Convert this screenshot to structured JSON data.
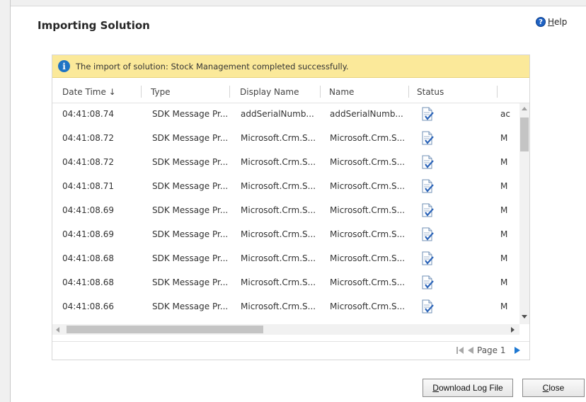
{
  "dialog": {
    "title": "Importing Solution",
    "help_label_first": "H",
    "help_label_rest": "elp"
  },
  "notice": {
    "icon": "info-icon",
    "message": "The import of solution: Stock Management completed successfully."
  },
  "grid": {
    "columns": [
      "Date Time ↓",
      "Type",
      "Display Name",
      "Name",
      "Status"
    ],
    "rows": [
      {
        "datetime": "04:41:08.74",
        "type": "SDK Message Pr...",
        "display_name": "addSerialNumb...",
        "name": "addSerialNumb...",
        "status_icon": "status-complete-icon",
        "extra": "ac"
      },
      {
        "datetime": "04:41:08.72",
        "type": "SDK Message Pr...",
        "display_name": "Microsoft.Crm.S...",
        "name": "Microsoft.Crm.S...",
        "status_icon": "status-complete-icon",
        "extra": "M"
      },
      {
        "datetime": "04:41:08.72",
        "type": "SDK Message Pr...",
        "display_name": "Microsoft.Crm.S...",
        "name": "Microsoft.Crm.S...",
        "status_icon": "status-complete-icon",
        "extra": "M"
      },
      {
        "datetime": "04:41:08.71",
        "type": "SDK Message Pr...",
        "display_name": "Microsoft.Crm.S...",
        "name": "Microsoft.Crm.S...",
        "status_icon": "status-complete-icon",
        "extra": "M"
      },
      {
        "datetime": "04:41:08.69",
        "type": "SDK Message Pr...",
        "display_name": "Microsoft.Crm.S...",
        "name": "Microsoft.Crm.S...",
        "status_icon": "status-complete-icon",
        "extra": "M"
      },
      {
        "datetime": "04:41:08.69",
        "type": "SDK Message Pr...",
        "display_name": "Microsoft.Crm.S...",
        "name": "Microsoft.Crm.S...",
        "status_icon": "status-complete-icon",
        "extra": "M"
      },
      {
        "datetime": "04:41:08.68",
        "type": "SDK Message Pr...",
        "display_name": "Microsoft.Crm.S...",
        "name": "Microsoft.Crm.S...",
        "status_icon": "status-complete-icon",
        "extra": "M"
      },
      {
        "datetime": "04:41:08.68",
        "type": "SDK Message Pr...",
        "display_name": "Microsoft.Crm.S...",
        "name": "Microsoft.Crm.S...",
        "status_icon": "status-complete-icon",
        "extra": "M"
      },
      {
        "datetime": "04:41:08.66",
        "type": "SDK Message Pr...",
        "display_name": "Microsoft.Crm.S...",
        "name": "Microsoft.Crm.S...",
        "status_icon": "status-complete-icon",
        "extra": "M"
      }
    ]
  },
  "pager": {
    "page_label": "Page 1"
  },
  "buttons": {
    "download_first": "D",
    "download_rest": "ownload Log File",
    "close_first": "C",
    "close_rest": "lose"
  },
  "colors": {
    "notice_bg": "#fbe99a",
    "info_blue": "#1f74c4",
    "pager_next": "#1e78d2"
  }
}
